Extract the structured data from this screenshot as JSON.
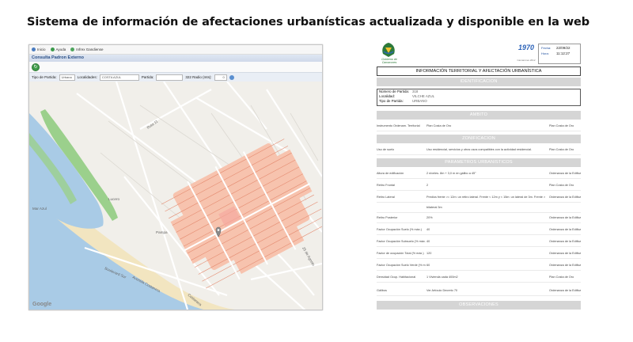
{
  "slide_title": "Sistema de información de afectaciones urbanísticas actualizada y disponible en la web",
  "map_app": {
    "toolbar": [
      {
        "label": "Inicio",
        "icon": "home-icon"
      },
      {
        "label": "Ayuda",
        "icon": "help-icon"
      },
      {
        "label": "Infrex Gandiense",
        "icon": "info-icon"
      }
    ],
    "app_title": "Consulta Padron Externo",
    "filters": {
      "tipo_label": "Tipo de Partida:",
      "tipo_value": "Urbana",
      "localidad_label": "Localidades:",
      "localidad_value": "COSTA AZUL",
      "partida_label": "Partida:",
      "partida_value": "",
      "radio_label": "322 Radio (mts):",
      "radio_value": "0"
    },
    "attribution": "Google",
    "street_labels": [
      "Mar Azul",
      "Boulevard Sur",
      "Avenida Costanera",
      "Ruta 11",
      "25 de Agosto",
      "Pampa",
      "Lucero",
      "Costanera"
    ],
    "colors": {
      "water": "#a9cbe6",
      "park": "#9bd08c",
      "sand": "#f2e5c0",
      "parcels": "#f7c3ae",
      "parcel_lines": "#e48b70",
      "land": "#f1efea"
    }
  },
  "report": {
    "logo_left_text": "Gobierno de Camarones",
    "logo_mid_text": "1970",
    "logo_mid_sub": "Camarones 2012",
    "date_label": "Fecha:",
    "date_value": "22/09/22",
    "time_label": "Hora:",
    "time_value": "11:12:27",
    "title": "INFORMACIÓN TERRITORIAL Y AFECTACIÓN URBANÍSTICA",
    "sections": {
      "identificacion": "IDENTIFICACION",
      "ambito": "AMBITO",
      "zonificacion": "ZONIFICACION",
      "parametros": "PARAMETROS URBANISTICOS",
      "observaciones": "OBSERVACIONES"
    },
    "identificacion": [
      {
        "label": "Número de Partida:",
        "value": "318"
      },
      {
        "label": "Localidad:",
        "value": "VILCHE AZUL"
      },
      {
        "label": "Tipo de Partida:",
        "value": "URBANO"
      }
    ],
    "ambito_row": {
      "c1": "Instrumento Ordenam. Territorial",
      "c2": "Plan Costa de Oro",
      "c3": "Plan Costa de Oro"
    },
    "zonificacion_row": {
      "c1": "Uso de suelo",
      "c2": "Uso residencial, servicios y otros usos compatibles con la actividad residencial.",
      "c3": "Plan Costa de Oro"
    },
    "parametros_rows": [
      {
        "c1": "Altura de edificación",
        "c2": "2 niveles. 8m + 3,0 m en gálibo a 45°",
        "c3": "Ordenanza de la Edificac."
      },
      {
        "c1": "Retiro Frontal",
        "c2": "2",
        "c3": "Plan Costa de Oro"
      },
      {
        "c1": "Retiro Lateral",
        "c2": "Predios frente >= 12m: un retiro lateral. Frente < 12m y < 15m: un lateral de 3m. Frente >= 15m",
        "c3": "Ordenanza de la Edificac."
      },
      {
        "c1": "",
        "c2": "bilateral 3m",
        "c3": ""
      },
      {
        "c1": "Retiro Posterior",
        "c2": "20%",
        "c3": "Ordenanza de la Edificac."
      },
      {
        "c1": "Factor Ocupación Suelo (% máx.)",
        "c2": "40",
        "c3": "Ordenanza de la Edificac."
      },
      {
        "c1": "Factor Ocupación Subsuelo (% máx.)",
        "c2": "40",
        "c3": "Ordenanza de la Edificac."
      },
      {
        "c1": "Factor de ocupación Total (% máx.)",
        "c2": "120",
        "c3": "Ordenanza de la Edificac."
      },
      {
        "c1": "Factor Ocupación Suelo Verde (% mín.)",
        "c2": "60",
        "c3": "Ordenanza de la Edificac."
      },
      {
        "c1": "Densidad Ocup. Habitacional",
        "c2": "1 Vivienda cada 400m2",
        "c3": "Plan Costa de Oro"
      },
      {
        "c1": "Gálibos",
        "c2": "Ver Artículo Decreto 70",
        "c3": "Ordenanza de la Edificac."
      }
    ]
  }
}
